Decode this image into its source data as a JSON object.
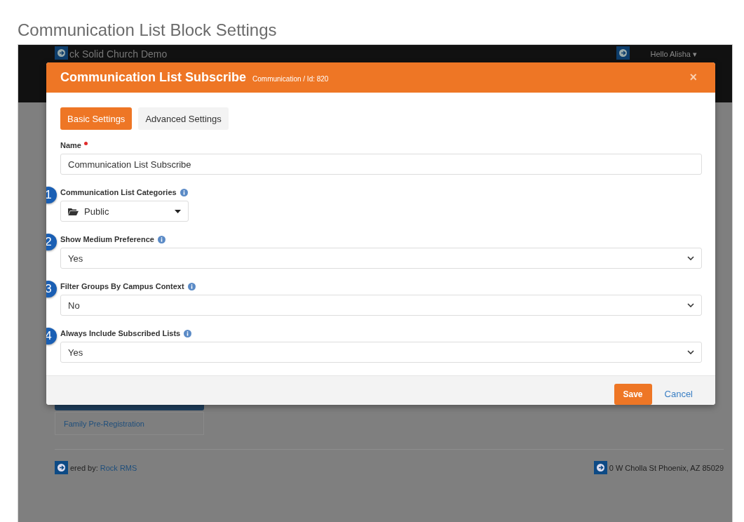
{
  "page_title": "Communication List Block Settings",
  "background": {
    "site_name": "ck Solid Church Demo",
    "user_menu": "Hello Alisha ▾",
    "nav_item": "Family Pre-Registration",
    "footer_left_prefix": "ered by:",
    "footer_left_link": "Rock RMS",
    "footer_right": "0 W Cholla St Phoenix, AZ 85029"
  },
  "modal": {
    "title": "Communication List Subscribe",
    "subtitle": "Communication / Id: 820",
    "close": "×",
    "tabs": [
      {
        "label": "Basic Settings",
        "selected": true
      },
      {
        "label": "Advanced Settings",
        "selected": false
      }
    ],
    "fields": [
      {
        "kind": "text",
        "label": "Name",
        "required": true,
        "value": "Communication List Subscribe"
      },
      {
        "kind": "category",
        "label": "Communication List Categories",
        "info": true,
        "callout": "1",
        "value": "Public"
      },
      {
        "kind": "select",
        "label": "Show Medium Preference",
        "info": true,
        "callout": "2",
        "value": "Yes"
      },
      {
        "kind": "select",
        "label": "Filter Groups By Campus Context",
        "info": true,
        "callout": "3",
        "value": "No"
      },
      {
        "kind": "select",
        "label": "Always Include Subscribed Lists",
        "info": true,
        "callout": "4",
        "value": "Yes"
      }
    ],
    "buttons": [
      {
        "kind": "primary",
        "label": "Save"
      },
      {
        "kind": "link",
        "label": "Cancel"
      }
    ]
  }
}
